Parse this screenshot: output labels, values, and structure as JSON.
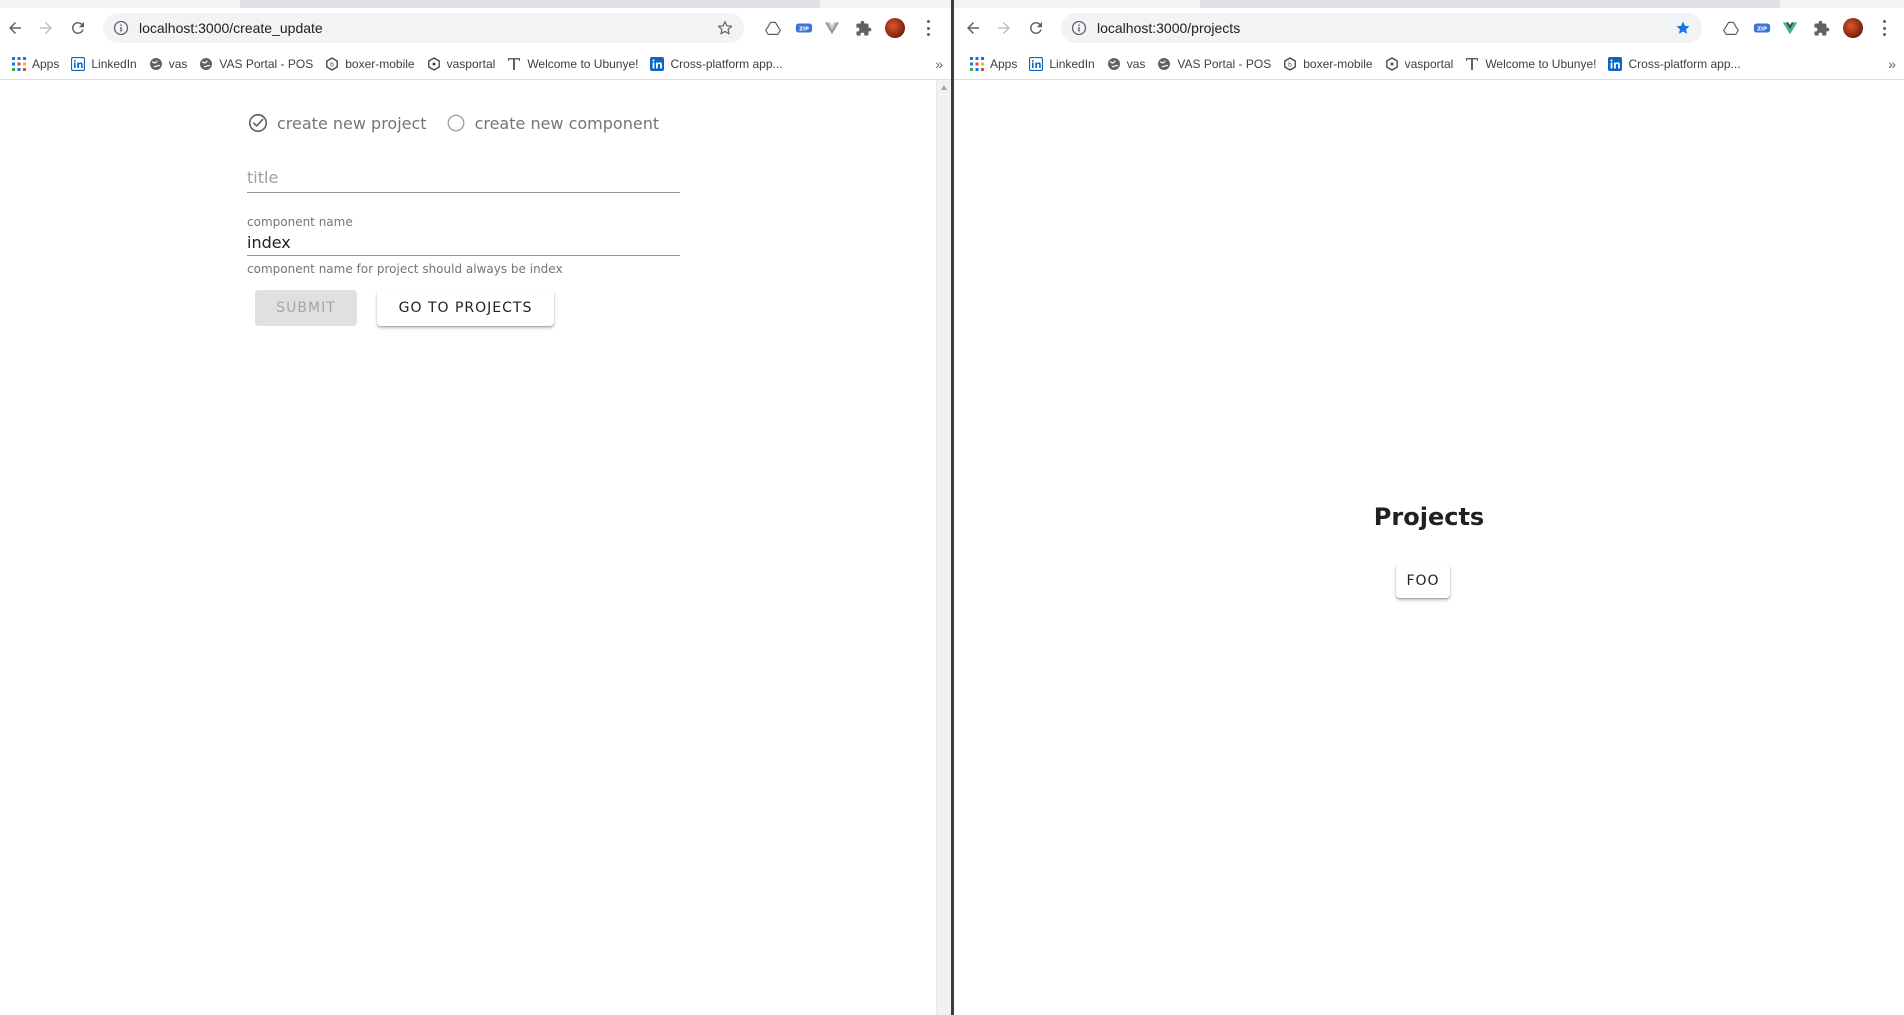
{
  "left_window": {
    "url": "localhost:3000/create_update",
    "bookmark_starred": false,
    "bookmarks": [
      "Apps",
      "LinkedIn",
      "vas",
      "VAS Portal - POS",
      "boxer-mobile",
      "vasportal",
      "Welcome to Ubunye!",
      "Cross-platform app..."
    ],
    "bookmarks_more": "»",
    "form": {
      "radio_project_label": "create new project",
      "radio_component_label": "create new component",
      "selected_radio": "create new project",
      "title_placeholder": "title",
      "title_value": "",
      "component_name_label": "component name",
      "component_name_value": "index",
      "component_name_helper": "component name for project should always be index",
      "submit_label": "SUBMIT",
      "submit_disabled": true,
      "go_to_projects_label": "GO TO PROJECTS"
    }
  },
  "right_window": {
    "url": "localhost:3000/projects",
    "bookmark_starred": true,
    "bookmarks": [
      "Apps",
      "LinkedIn",
      "vas",
      "VAS Portal - POS",
      "boxer-mobile",
      "vasportal",
      "Welcome to Ubunye!",
      "Cross-platform app..."
    ],
    "bookmarks_more": "»",
    "page": {
      "title": "Projects",
      "project_button_label": "FOO"
    }
  },
  "icons": [
    "back-arrow-icon",
    "forward-arrow-icon",
    "reload-icon",
    "info-icon",
    "star-icon",
    "drive-icon",
    "zip-icon",
    "vue-devtools-icon",
    "puzzle-extensions-icon",
    "profile-avatar",
    "kebab-menu-icon",
    "apps-grid-icon",
    "linkedin-icon",
    "globe-icon",
    "hexagon-icon",
    "serif-t-icon"
  ],
  "colors": {
    "star_active": "#1a73e8",
    "vue_green": "#41b883",
    "linkedin_blue": "#0a66c2",
    "omnibox_bg": "#f1f3f4",
    "disabled_button": "#e0e0e0"
  }
}
